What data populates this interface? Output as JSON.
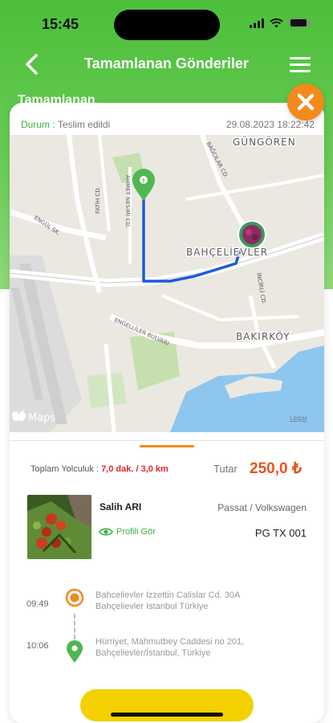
{
  "status_bar": {
    "time": "15:45"
  },
  "header": {
    "title": "Tamamlanan Gönderiler",
    "underlying_heading": "Tamamlanan"
  },
  "shipment": {
    "status_label": "Durum :",
    "status_value": "Teslim edildi",
    "datetime": "29.08.2023 18:22:42"
  },
  "map": {
    "attribution": "Maps",
    "legal": "Legal",
    "places": [
      "GÜNGÖREN",
      "BAHÇELİEVLER",
      "BAKIRKÖY"
    ],
    "streets": [
      "BAĞCILAR CD.",
      "FATİH CD.",
      "AHMET NESİMİ CD.",
      "İNCİRLİ CD.",
      "ENGÜL SK.",
      "ENGELLİLER BULVARI"
    ]
  },
  "trip": {
    "label": "Toplam Yolculuk :",
    "value": "7,0 dak. / 3,0 km",
    "price_label": "Tutar",
    "price_value": "250,0 ₺"
  },
  "driver": {
    "name": "Salih ARI",
    "vehicle": "Passat / Volkswagen",
    "profile_link": "Profili Gör",
    "plate": "PG TX 001"
  },
  "route": [
    {
      "time": "09:49",
      "address": "Bahcelievler Izzettin Calislar Cd. 30A Bahçelievler Istanbul Türkiye"
    },
    {
      "time": "10:06",
      "address": "Hürriyet, Mahmutbey Caddesi no 201, Bahçelievler/İstanbul, Türkiye"
    }
  ],
  "colors": {
    "green": "#3bb143",
    "orange": "#f28a1c",
    "price": "#e8531b",
    "route_line": "#1e5bd8"
  }
}
